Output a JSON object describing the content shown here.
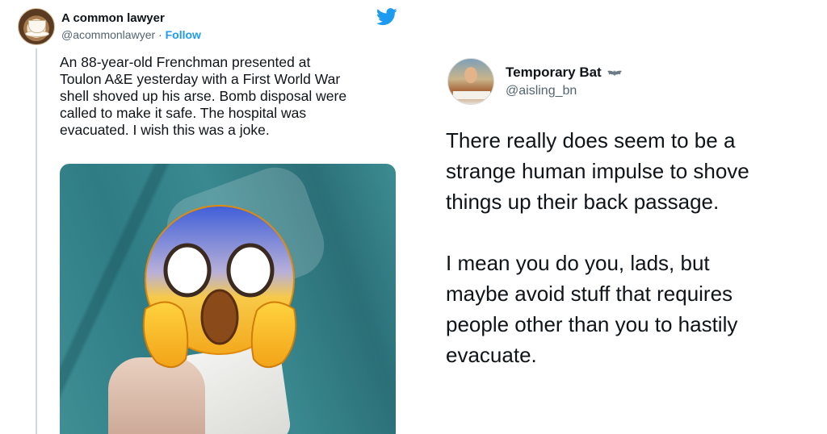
{
  "left_tweet": {
    "display_name": "A common lawyer",
    "handle": "@acommonlawyer",
    "separator": " · ",
    "follow_label": "Follow",
    "text_lines": [
      "An 88-year-old Frenchman presented at",
      "Toulon A&E yesterday with a First World War",
      "shell shoved up his arse. Bomb disposal were",
      "called to make it safe. The hospital was",
      "evacuated. I wish this was a joke."
    ],
    "icons": {
      "brand": "twitter-bird-icon",
      "overlay": "screaming-face-emoji-icon"
    },
    "colors": {
      "link": "#1d9bf0",
      "secondary_text": "#536471"
    }
  },
  "right_tweet": {
    "display_name": "Temporary Bat",
    "name_icon": "bat-icon",
    "handle": "@aisling_bn",
    "paragraph1": [
      "There really does seem to be a",
      "strange human impulse to shove",
      "things up their back passage."
    ],
    "paragraph2": [
      "I mean you do you, lads, but",
      "maybe avoid stuff that requires",
      "people other than you to hastily",
      "evacuate."
    ]
  }
}
